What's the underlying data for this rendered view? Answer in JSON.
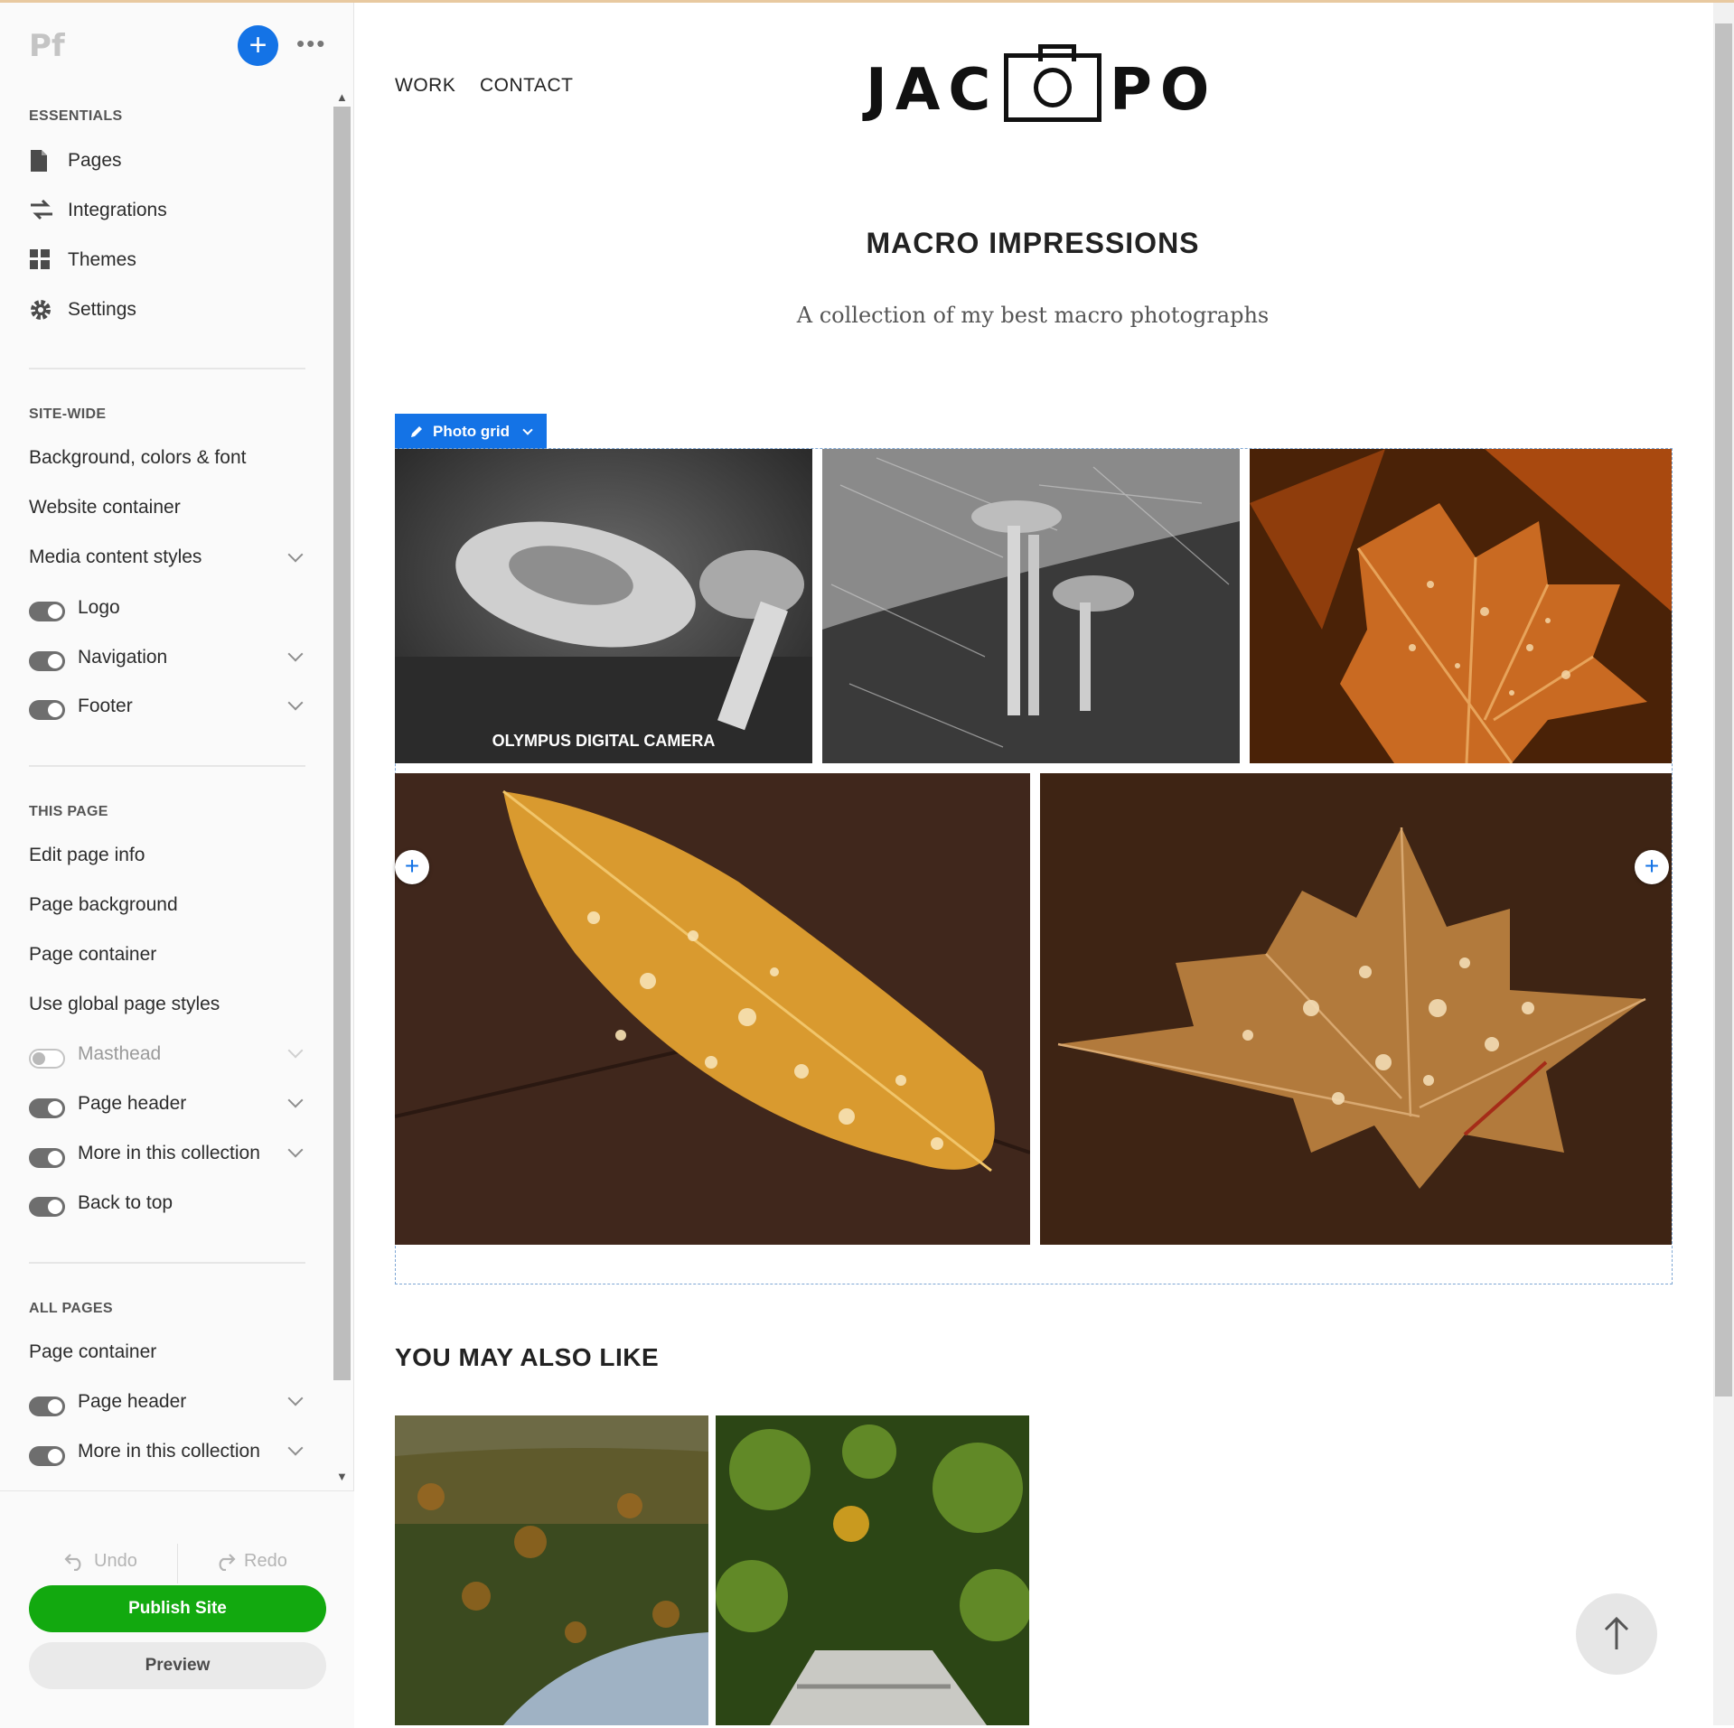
{
  "app": {
    "logo_text": "Pf",
    "add_label": "+",
    "more_label": "•••"
  },
  "sidebar": {
    "essentials_heading": "ESSENTIALS",
    "essentials": [
      {
        "label": "Pages",
        "icon": "page-icon"
      },
      {
        "label": "Integrations",
        "icon": "integrations-icon"
      },
      {
        "label": "Themes",
        "icon": "themes-icon"
      },
      {
        "label": "Settings",
        "icon": "gear-icon"
      }
    ],
    "sitewide_heading": "SITE-WIDE",
    "sitewide": [
      {
        "label": "Background, colors & font"
      },
      {
        "label": "Website container"
      },
      {
        "label": "Media content styles",
        "chevron": true
      },
      {
        "label": "Logo",
        "toggle": "on"
      },
      {
        "label": "Navigation",
        "toggle": "on",
        "chevron": true
      },
      {
        "label": "Footer",
        "toggle": "on",
        "chevron": true
      }
    ],
    "thispage_heading": "THIS PAGE",
    "thispage": [
      {
        "label": "Edit page info"
      },
      {
        "label": "Page background"
      },
      {
        "label": "Page container"
      },
      {
        "label": "Use global page styles"
      },
      {
        "label": "Masthead",
        "toggle": "off",
        "chevron": true
      },
      {
        "label": "Page header",
        "toggle": "on",
        "chevron": true
      },
      {
        "label": "More in this collection",
        "toggle": "on",
        "chevron": true
      },
      {
        "label": "Back to top",
        "toggle": "on"
      }
    ],
    "allpages_heading": "ALL PAGES",
    "allpages": [
      {
        "label": "Page container"
      },
      {
        "label": "Page header",
        "toggle": "on",
        "chevron": true
      },
      {
        "label": "More in this collection",
        "toggle": "on",
        "chevron": true
      }
    ],
    "undo_label": "Undo",
    "redo_label": "Redo",
    "publish_label": "Publish Site",
    "preview_label": "Preview"
  },
  "site": {
    "nav": [
      "WORK",
      "CONTACT"
    ],
    "logo_left": "JAC",
    "logo_right": "PO",
    "title": "MACRO IMPRESSIONS",
    "subtitle": "A collection of my best macro photographs",
    "grid_tag_label": "Photo grid",
    "photo_caption": "OLYMPUS DIGITAL CAMERA",
    "also_heading": "YOU MAY ALSO LIKE"
  },
  "colors": {
    "accent": "#1473e6",
    "publish": "#12a90f"
  }
}
